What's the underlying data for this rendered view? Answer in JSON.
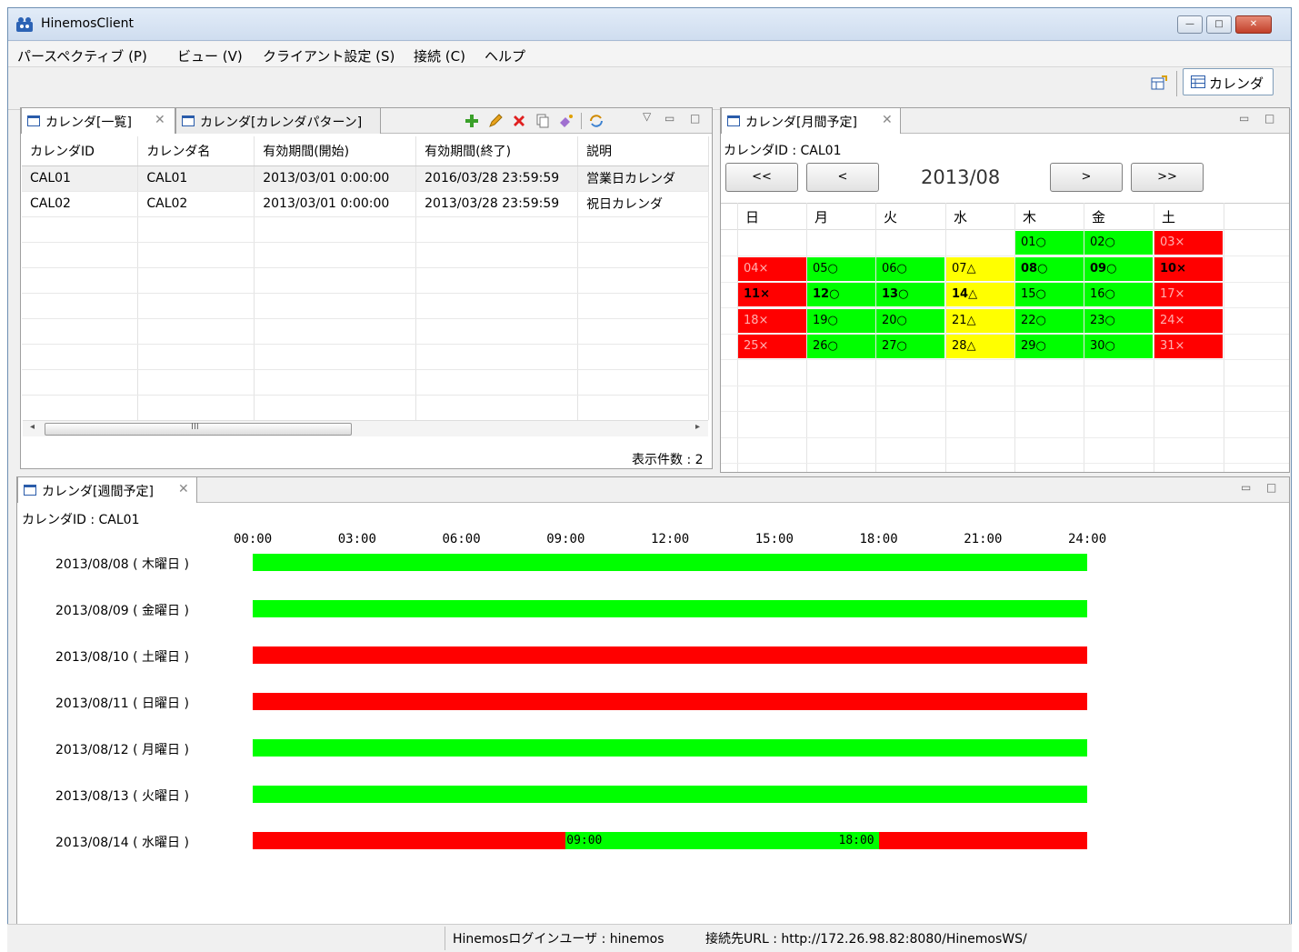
{
  "window": {
    "title": "HinemosClient"
  },
  "menu": [
    "パースペクティブ (P)",
    "ビュー (V)",
    "クライアント設定 (S)",
    "接続 (C)",
    "ヘルプ"
  ],
  "perspective": {
    "label": "カレンダ"
  },
  "list_panel": {
    "tabs": [
      "カレンダ[一覧]",
      "カレンダ[カレンダパターン]"
    ],
    "columns": [
      "カレンダID",
      "カレンダ名",
      "有効期間(開始)",
      "有効期間(終了)",
      "説明"
    ],
    "rows": [
      [
        "CAL01",
        "CAL01",
        "2013/03/01 0:00:00",
        "2016/03/28 23:59:59",
        "営業日カレンダ"
      ],
      [
        "CAL02",
        "CAL02",
        "2013/03/01 0:00:00",
        "2013/03/28 23:59:59",
        "祝日カレンダ"
      ]
    ],
    "count_label": "表示件数 : 2",
    "scroll_grip": "III"
  },
  "month_panel": {
    "tab": "カレンダ[月間予定]",
    "calendar_id_label": "カレンダID : CAL01",
    "month": "2013/08",
    "nav": [
      "<<",
      "<",
      ">",
      ">>"
    ],
    "weekdays": [
      "日",
      "月",
      "火",
      "水",
      "木",
      "金",
      "土"
    ],
    "weeks": [
      [
        null,
        null,
        null,
        null,
        {
          "t": "01○",
          "s": "ok"
        },
        {
          "t": "02○",
          "s": "ok"
        },
        {
          "t": "03×",
          "s": "ng"
        }
      ],
      [
        {
          "t": "04×",
          "s": "ng"
        },
        {
          "t": "05○",
          "s": "ok"
        },
        {
          "t": "06○",
          "s": "ok"
        },
        {
          "t": "07△",
          "s": "part"
        },
        {
          "t": "08○",
          "s": "ok",
          "b": true
        },
        {
          "t": "09○",
          "s": "ok",
          "b": true
        },
        {
          "t": "10×",
          "s": "ng",
          "b": true
        }
      ],
      [
        {
          "t": "11×",
          "s": "ng",
          "b": true
        },
        {
          "t": "12○",
          "s": "ok",
          "b": true
        },
        {
          "t": "13○",
          "s": "ok",
          "b": true
        },
        {
          "t": "14△",
          "s": "part",
          "b": true
        },
        {
          "t": "15○",
          "s": "ok"
        },
        {
          "t": "16○",
          "s": "ok"
        },
        {
          "t": "17×",
          "s": "ng"
        }
      ],
      [
        {
          "t": "18×",
          "s": "ng"
        },
        {
          "t": "19○",
          "s": "ok"
        },
        {
          "t": "20○",
          "s": "ok"
        },
        {
          "t": "21△",
          "s": "part"
        },
        {
          "t": "22○",
          "s": "ok"
        },
        {
          "t": "23○",
          "s": "ok"
        },
        {
          "t": "24×",
          "s": "ng"
        }
      ],
      [
        {
          "t": "25×",
          "s": "ng"
        },
        {
          "t": "26○",
          "s": "ok"
        },
        {
          "t": "27○",
          "s": "ok"
        },
        {
          "t": "28△",
          "s": "part"
        },
        {
          "t": "29○",
          "s": "ok"
        },
        {
          "t": "30○",
          "s": "ok"
        },
        {
          "t": "31×",
          "s": "ng"
        }
      ]
    ]
  },
  "week_panel": {
    "tab": "カレンダ[週間予定]",
    "calendar_id_label": "カレンダID : CAL01",
    "hours": [
      "00:00",
      "03:00",
      "06:00",
      "09:00",
      "12:00",
      "15:00",
      "18:00",
      "21:00",
      "24:00"
    ],
    "days": [
      {
        "label": "2013/08/08 ( 木曜日 )",
        "segments": [
          {
            "from": 0,
            "to": 24,
            "s": "ok"
          }
        ]
      },
      {
        "label": "2013/08/09 ( 金曜日 )",
        "segments": [
          {
            "from": 0,
            "to": 24,
            "s": "ok"
          }
        ]
      },
      {
        "label": "2013/08/10 ( 土曜日 )",
        "segments": [
          {
            "from": 0,
            "to": 24,
            "s": "ng"
          }
        ]
      },
      {
        "label": "2013/08/11 ( 日曜日 )",
        "segments": [
          {
            "from": 0,
            "to": 24,
            "s": "ng"
          }
        ]
      },
      {
        "label": "2013/08/12 ( 月曜日 )",
        "segments": [
          {
            "from": 0,
            "to": 24,
            "s": "ok"
          }
        ]
      },
      {
        "label": "2013/08/13 ( 火曜日 )",
        "segments": [
          {
            "from": 0,
            "to": 24,
            "s": "ok"
          }
        ]
      },
      {
        "label": "2013/08/14 ( 水曜日 )",
        "segments": [
          {
            "from": 0,
            "to": 9,
            "s": "ng"
          },
          {
            "from": 9,
            "to": 18,
            "s": "ok",
            "label": "09:00"
          },
          {
            "from": 18,
            "to": 24,
            "s": "ng",
            "label": "18:00"
          }
        ]
      }
    ]
  },
  "colors": {
    "ok": "#00ff00",
    "ng": "#ff0000",
    "part": "#ffff00"
  },
  "status": {
    "user": "Hinemosログインユーザ : hinemos",
    "url": "接続先URL : http://172.26.98.82:8080/HinemosWS/"
  }
}
